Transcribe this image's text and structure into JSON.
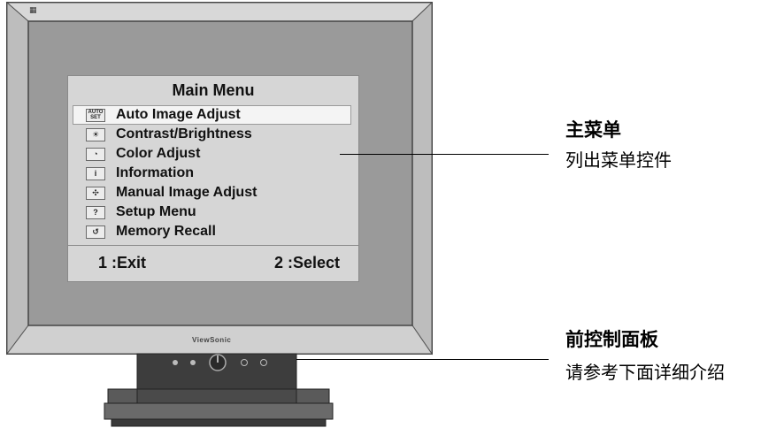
{
  "osd": {
    "title": "Main Menu",
    "items": [
      {
        "label": "Auto Image Adjust",
        "icon": "auto-set-icon",
        "icon_text": [
          "AUTO",
          "SET"
        ],
        "selected": true
      },
      {
        "label": "Contrast/Brightness",
        "icon": "sun-icon",
        "icon_text": "☀"
      },
      {
        "label": "Color Adjust",
        "icon": "palette-icon",
        "icon_text": "◔"
      },
      {
        "label": "Information",
        "icon": "info-icon",
        "icon_text": "i"
      },
      {
        "label": "Manual Image Adjust",
        "icon": "move-arrows-icon",
        "icon_text": "✣"
      },
      {
        "label": "Setup Menu",
        "icon": "question-icon",
        "icon_text": "?"
      },
      {
        "label": "Memory Recall",
        "icon": "recall-icon",
        "icon_text": "↺"
      }
    ],
    "footer_exit": "1 :Exit",
    "footer_select": "2 :Select"
  },
  "callouts": {
    "main_menu": {
      "title": "主菜单",
      "desc": "列出菜单控件"
    },
    "front_panel": {
      "title": "前控制面板",
      "desc": "请参考下面详细介绍"
    }
  },
  "brand_text": "ViewSonic",
  "colors": {
    "bezel": "#c9c9c9",
    "screen": "#9a9a9a",
    "osd_bg": "#d6d6d6",
    "stand": "#3d3d3d"
  }
}
